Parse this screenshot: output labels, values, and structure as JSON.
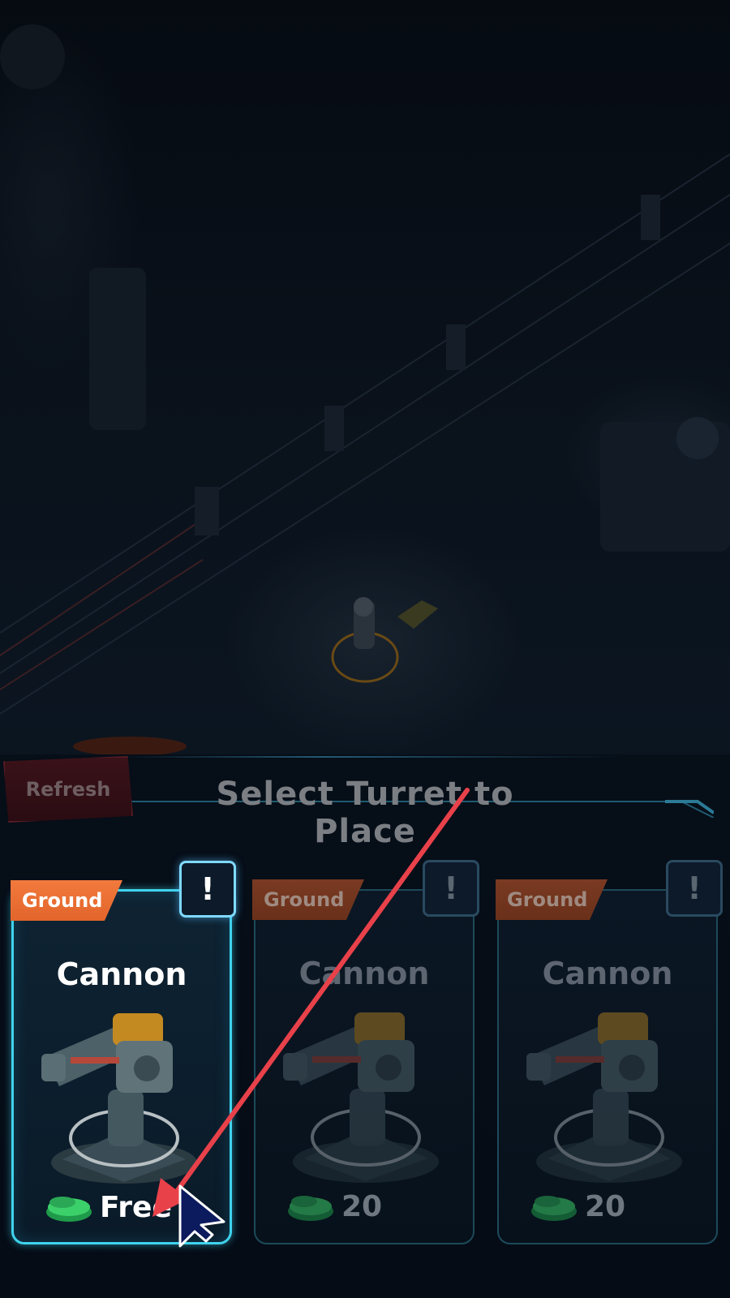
{
  "panel": {
    "refresh_label": "Refresh",
    "title": "Select Turret to Place"
  },
  "cards": [
    {
      "category": "Ground",
      "name": "Cannon",
      "cost": "Free",
      "info": "!",
      "state": "selected"
    },
    {
      "category": "Ground",
      "name": "Cannon",
      "cost": "20",
      "info": "!",
      "state": "dimmed"
    },
    {
      "category": "Ground",
      "name": "Cannon",
      "cost": "20",
      "info": "!",
      "state": "dimmed"
    }
  ],
  "colors": {
    "accent": "#3fd3ee",
    "badge": "#f27a3d",
    "annotation_arrow": "#e8414a",
    "cursor": "#0c1a5e"
  },
  "icons": [
    "bottle-cap-icon",
    "cursor-icon",
    "info-icon"
  ]
}
